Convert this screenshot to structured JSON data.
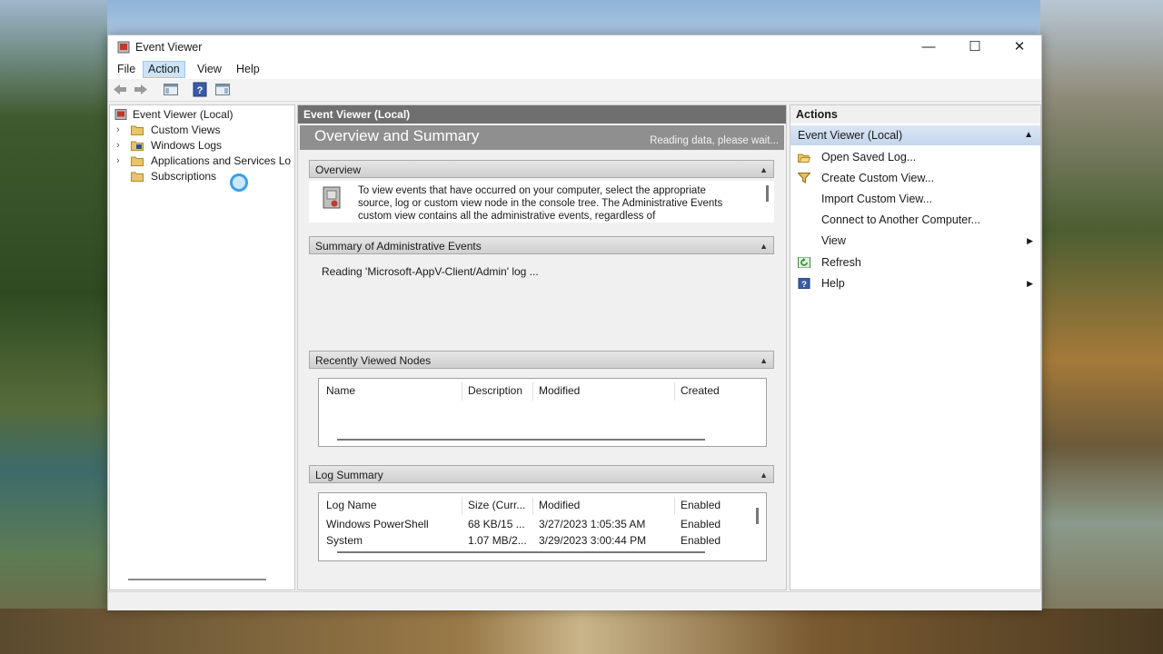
{
  "window": {
    "title": "Event Viewer"
  },
  "window_controls": {
    "minimize": "—",
    "maximize": "☐",
    "close": "✕"
  },
  "menu": [
    "File",
    "Action",
    "View",
    "Help"
  ],
  "tree": {
    "root": "Event Viewer (Local)",
    "items": [
      "Custom Views",
      "Windows Logs",
      "Applications and Services Lo",
      "Subscriptions"
    ]
  },
  "center": {
    "header": "Event Viewer (Local)",
    "banner_title": "Overview and Summary",
    "banner_status": "Reading data, please wait...",
    "overview": {
      "heading": "Overview",
      "text": "To view events that have occurred on your computer, select the appropriate source, log or custom view node in the console tree. The Administrative Events custom view contains all the administrative events, regardless of"
    },
    "summary": {
      "heading": "Summary of Administrative Events",
      "text": "Reading 'Microsoft-AppV-Client/Admin' log ..."
    },
    "recent": {
      "heading": "Recently Viewed Nodes",
      "columns": [
        "Name",
        "Description",
        "Modified",
        "Created"
      ]
    },
    "log_summary": {
      "heading": "Log Summary",
      "columns": [
        "Log Name",
        "Size (Curr...",
        "Modified",
        "Enabled"
      ],
      "rows": [
        [
          "Windows PowerShell",
          "68 KB/15 ...",
          "3/27/2023 1:05:35 AM",
          "Enabled"
        ],
        [
          "System",
          "1.07 MB/2...",
          "3/29/2023 3:00:44 PM",
          "Enabled"
        ]
      ]
    }
  },
  "actions": {
    "header": "Actions",
    "section": "Event Viewer (Local)",
    "items": [
      {
        "label": "Open Saved Log...",
        "icon": "folder-open-icon"
      },
      {
        "label": "Create Custom View...",
        "icon": "filter-icon"
      },
      {
        "label": "Import Custom View...",
        "icon": ""
      },
      {
        "label": "Connect to Another Computer...",
        "icon": ""
      },
      {
        "label": "View",
        "icon": ""
      },
      {
        "label": "Refresh",
        "icon": "refresh-icon"
      },
      {
        "label": "Help",
        "icon": "help-icon"
      }
    ]
  },
  "colors": {
    "accent": "#3aa0e8",
    "header_dark": "#6f6f6f",
    "actions_sub": "#c5d6ec"
  }
}
